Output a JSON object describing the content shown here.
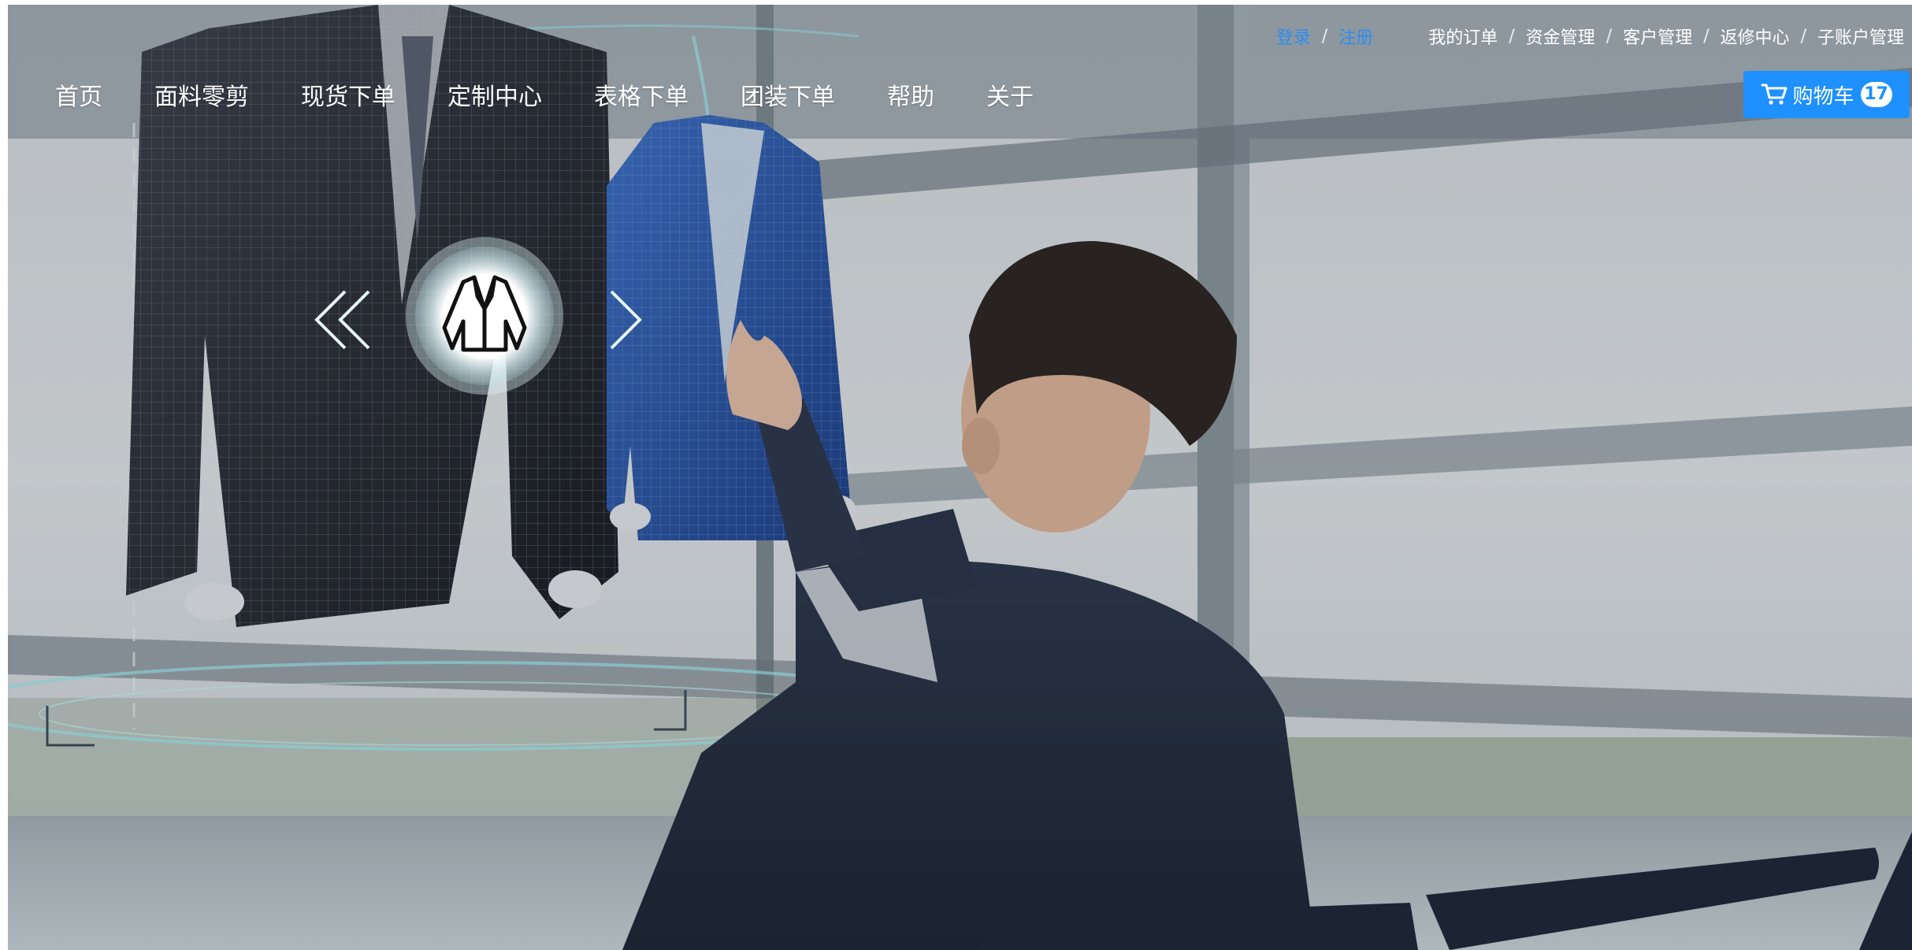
{
  "topbar": {
    "login": "登录",
    "register": "注册",
    "separator": "/",
    "links": [
      "我的订单",
      "资金管理",
      "客户管理",
      "返修中心",
      "子账户管理"
    ]
  },
  "nav": {
    "items": [
      "首页",
      "面料零剪",
      "现货下单",
      "定制中心",
      "表格下单",
      "团装下单",
      "帮助",
      "关于"
    ]
  },
  "cart": {
    "label": "购物车",
    "count": "17",
    "icon": "cart-icon"
  },
  "hero": {
    "icon": "jacket-icon",
    "prev_icon": "double-chevron-left-icon",
    "next_icon": "chevron-right-icon"
  },
  "colors": {
    "accent": "#1e90ff",
    "login_link": "#2d8cf0",
    "nav_text": "#ffffff"
  }
}
